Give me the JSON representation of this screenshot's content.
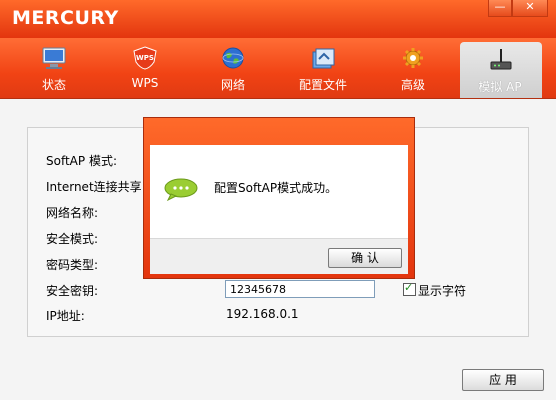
{
  "brand": "MERCURY",
  "window_controls": {
    "minimize": "—",
    "close": "✕"
  },
  "toolbar": {
    "tabs": [
      {
        "label": "状态",
        "icon": "monitor-icon"
      },
      {
        "label": "WPS",
        "icon": "wps-shield-icon"
      },
      {
        "label": "网络",
        "icon": "globe-icon"
      },
      {
        "label": "配置文件",
        "icon": "config-file-icon"
      },
      {
        "label": "高级",
        "icon": "gear-icon"
      },
      {
        "label": "模拟 AP",
        "icon": "router-icon",
        "active": true
      }
    ]
  },
  "form": {
    "softap_mode": "SoftAP 模式:",
    "internet_share": "Internet连接共享:",
    "network_name": "网络名称:",
    "security_mode": "安全模式:",
    "cipher_type": "密码类型:",
    "security_key": "安全密钥:",
    "security_key_value": "12345678",
    "show_chars": "显示字符",
    "ip_label": "IP地址:",
    "ip_value": "192.168.0.1",
    "apply": "应 用"
  },
  "dialog": {
    "message": "配置SoftAP模式成功。",
    "ok": "确 认"
  },
  "colors": {
    "accent": "#f04a18",
    "title": "#e3350e"
  }
}
